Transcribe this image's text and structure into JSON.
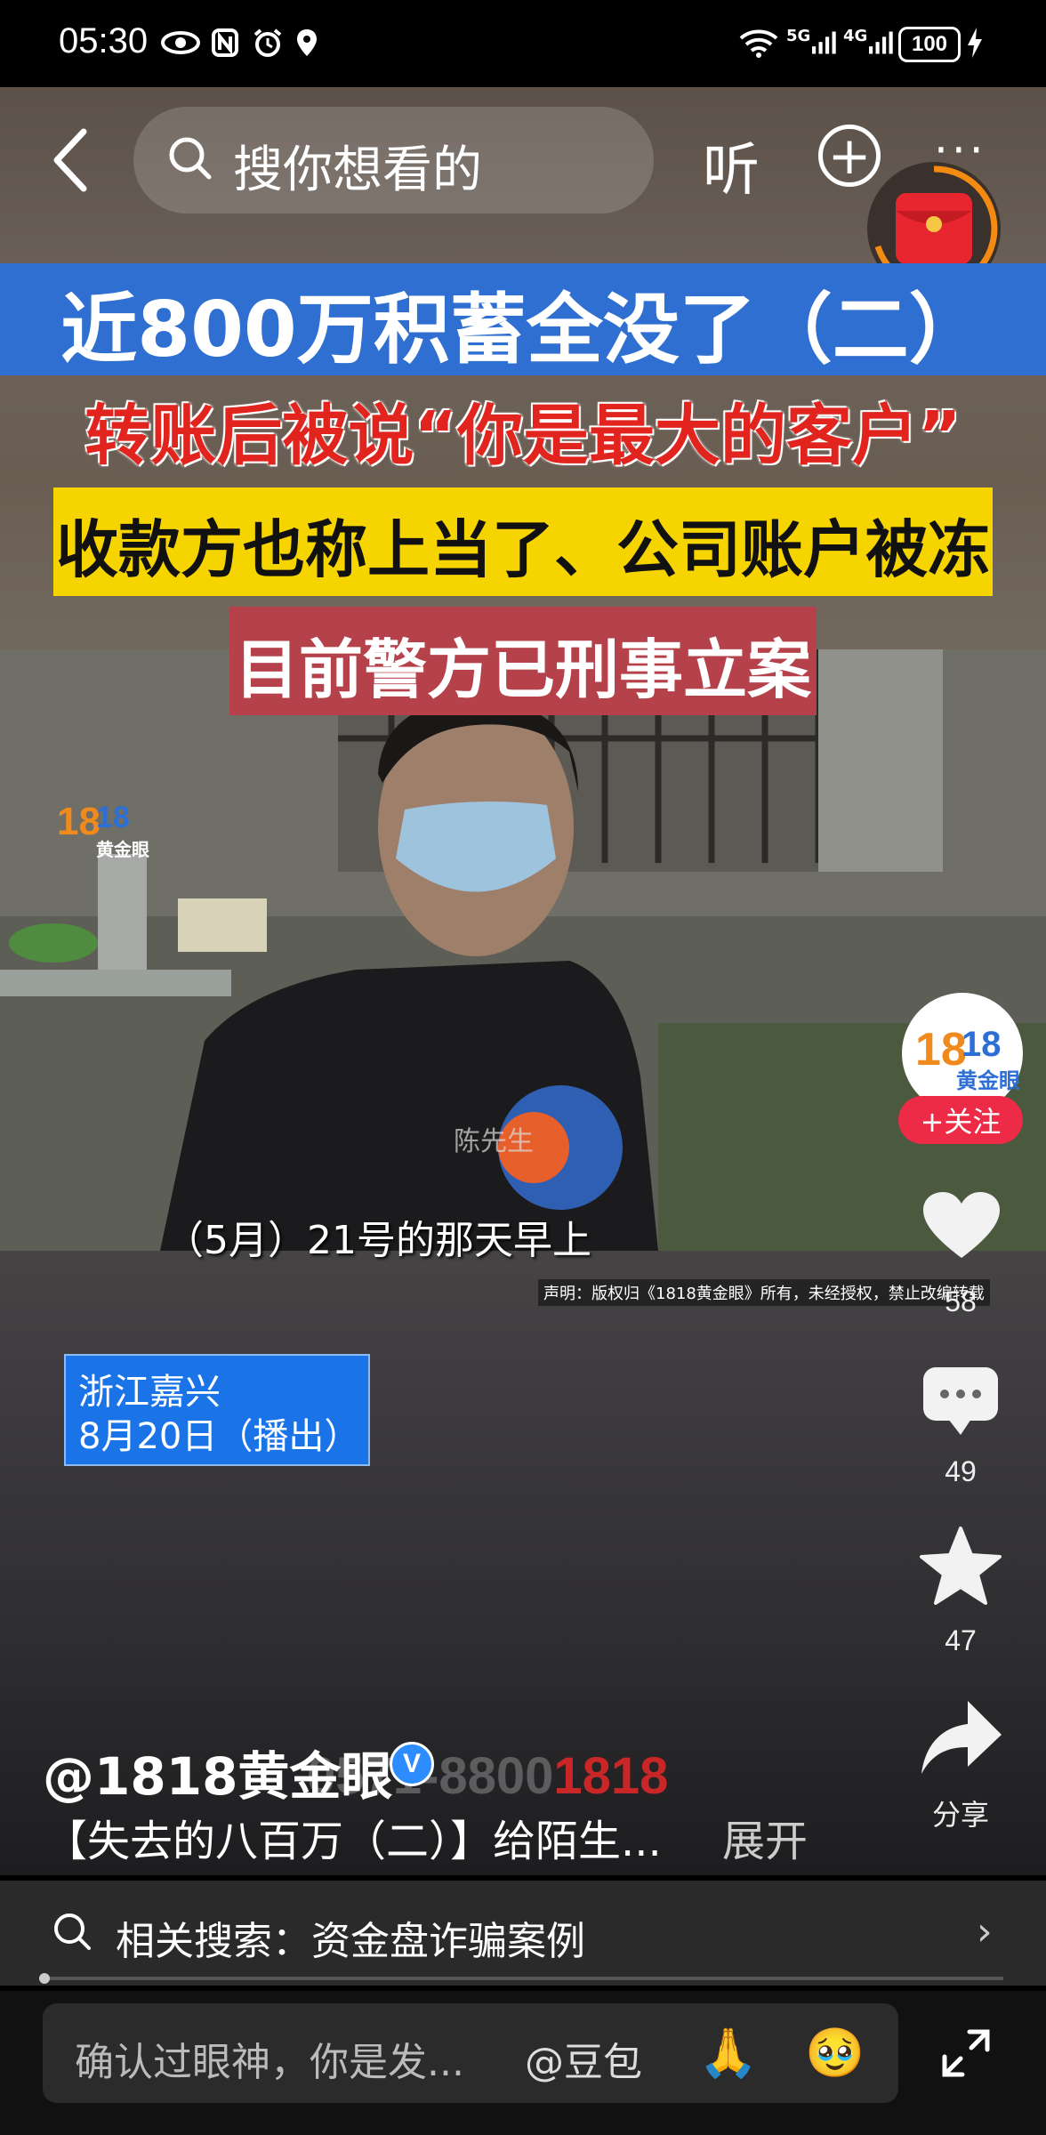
{
  "status": {
    "time": "05:30",
    "battery": "100",
    "signal1": "5G",
    "signal2": "4G"
  },
  "nav": {
    "search_placeholder": "搜你想看的",
    "listen": "听"
  },
  "banners": {
    "line1": "近800万积蓄全没了（二）",
    "line2": "转账后被说“你是最大的客户”",
    "line3": "收款方也称上当了、公司账户被冻结",
    "line4": "目前警方已刑事立案"
  },
  "video": {
    "subtitle": "（5月）21号的那天早上",
    "name_tag": "陈先生",
    "copyright": "声明：版权归《1818黄金眼》所有，未经授权，禁止改编转载",
    "location": "浙江嘉兴",
    "broadcast": "8月20日（播出）",
    "hotline_prefix": "0571-8800",
    "hotline_suffix": "1818",
    "logo_text": "黄金眼"
  },
  "rail": {
    "follow": "+关注",
    "likes": "58",
    "comments": "49",
    "favorites": "47",
    "share": "分享"
  },
  "info": {
    "author": "@1818黄金眼",
    "verified_badge": "V",
    "description": "【失去的八百万（二）】给陌生...",
    "expand": "展开"
  },
  "related": {
    "label": "相关搜索：资金盘诈骗案例"
  },
  "comment_bar": {
    "placeholder": "确认过眼神，你是发...",
    "mention": "@豆包",
    "emoji1": "🙏",
    "emoji2": "🥹"
  },
  "colors": {
    "blue_banner": "#2f6fd1",
    "yellow_banner": "#f5d400",
    "red_banner": "#b5414a",
    "follow_red": "#ee2b47",
    "location_blue": "#1a74e8"
  }
}
